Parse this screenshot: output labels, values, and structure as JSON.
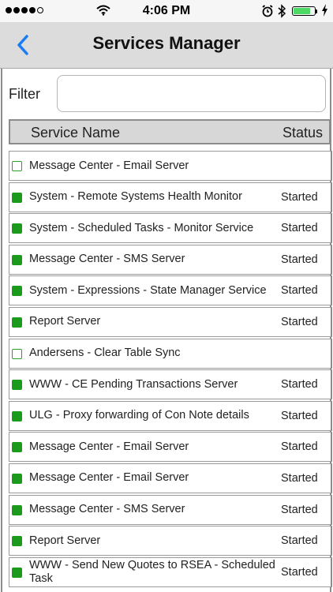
{
  "status_bar": {
    "time": "4:06 PM",
    "signal_dots_filled": 4,
    "signal_dots_total": 5,
    "battery_level": 0.8,
    "battery_color": "#4cd964",
    "icons": [
      "signal-icon",
      "wifi-icon",
      "alarm-icon",
      "bluetooth-icon",
      "battery-icon",
      "charging-icon"
    ]
  },
  "navbar": {
    "title": "Services Manager",
    "back_icon": "chevron-left-icon",
    "accent_color": "#1a7cf5"
  },
  "filter": {
    "label": "Filter",
    "value": "",
    "placeholder": ""
  },
  "table": {
    "columns": [
      "Service Name",
      "Status"
    ],
    "rows": [
      {
        "name": "Message Center - Email Server",
        "status": "",
        "active": false
      },
      {
        "name": "System - Remote Systems Health Monitor",
        "status": "Started",
        "active": true
      },
      {
        "name": "System - Scheduled Tasks - Monitor Service",
        "status": "Started",
        "active": true
      },
      {
        "name": "Message Center - SMS Server",
        "status": "Started",
        "active": true
      },
      {
        "name": "System - Expressions - State Manager Service",
        "status": "Started",
        "active": true
      },
      {
        "name": "Report Server",
        "status": "Started",
        "active": true
      },
      {
        "name": "Andersens - Clear Table Sync",
        "status": "",
        "active": false
      },
      {
        "name": "WWW - CE Pending Transactions Server",
        "status": "Started",
        "active": true
      },
      {
        "name": "ULG - Proxy forwarding of Con Note details",
        "status": "Started",
        "active": true
      },
      {
        "name": "Message Center - Email Server",
        "status": "Started",
        "active": true
      },
      {
        "name": "Message Center - Email Server",
        "status": "Started",
        "active": true
      },
      {
        "name": "Message Center - SMS Server",
        "status": "Started",
        "active": true
      },
      {
        "name": "Report Server",
        "status": "Started",
        "active": true
      },
      {
        "name": "WWW - Send New Quotes to RSEA - Scheduled Task",
        "status": "Started",
        "active": true
      }
    ],
    "status_colors": {
      "started": "#1c9a1c",
      "stopped_border": "#2aa02a"
    }
  }
}
